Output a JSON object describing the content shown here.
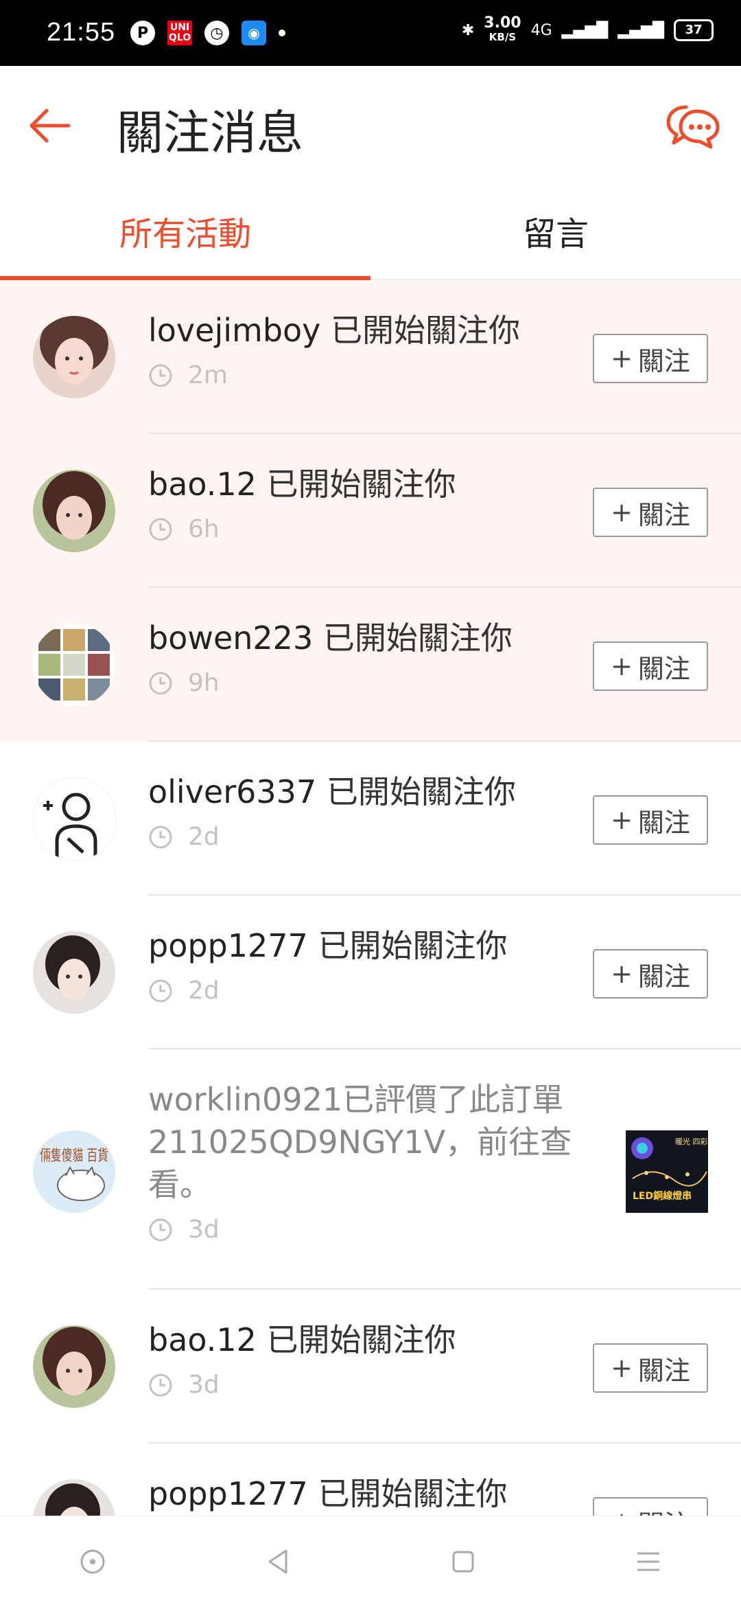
{
  "status_bar": {
    "time": "21:55",
    "net_speed": "3.00",
    "net_unit": "KB/S",
    "network": "4G",
    "battery": "37"
  },
  "header": {
    "title": "關注消息"
  },
  "tabs": [
    {
      "label": "所有活動",
      "active": true
    },
    {
      "label": "留言",
      "active": false
    }
  ],
  "notifications": [
    {
      "user": "lovejimboy",
      "action": "已開始關注你",
      "time": "2m",
      "button": "關注"
    },
    {
      "user": "bao.12",
      "action": "已開始關注你",
      "time": "6h",
      "button": "關注"
    },
    {
      "user": "bowen223",
      "action": "已開始關注你",
      "time": "9h",
      "button": "關注"
    },
    {
      "user": "oliver6337",
      "action": "已開始關注你",
      "time": "2d",
      "button": "關注"
    },
    {
      "user": "popp1277",
      "action": "已開始關注你",
      "time": "2d",
      "button": "關注"
    },
    {
      "text": "worklin0921已評價了此訂單211025QD9NGY1V，前往查看。",
      "time": "3d",
      "thumb_label": "LED銅線燈串",
      "thumb_tag": "暖光 四彩"
    },
    {
      "user": "bao.12",
      "action": "已開始關注你",
      "time": "3d",
      "button": "關注"
    },
    {
      "user": "popp1277",
      "action": "已開始關注你",
      "time": "",
      "button": "關注"
    }
  ],
  "avatar_cat_text": "倆隻傻貓 百貨",
  "colors": {
    "accent": "#ee4d2d",
    "unread_bg": "#fef4f2"
  }
}
